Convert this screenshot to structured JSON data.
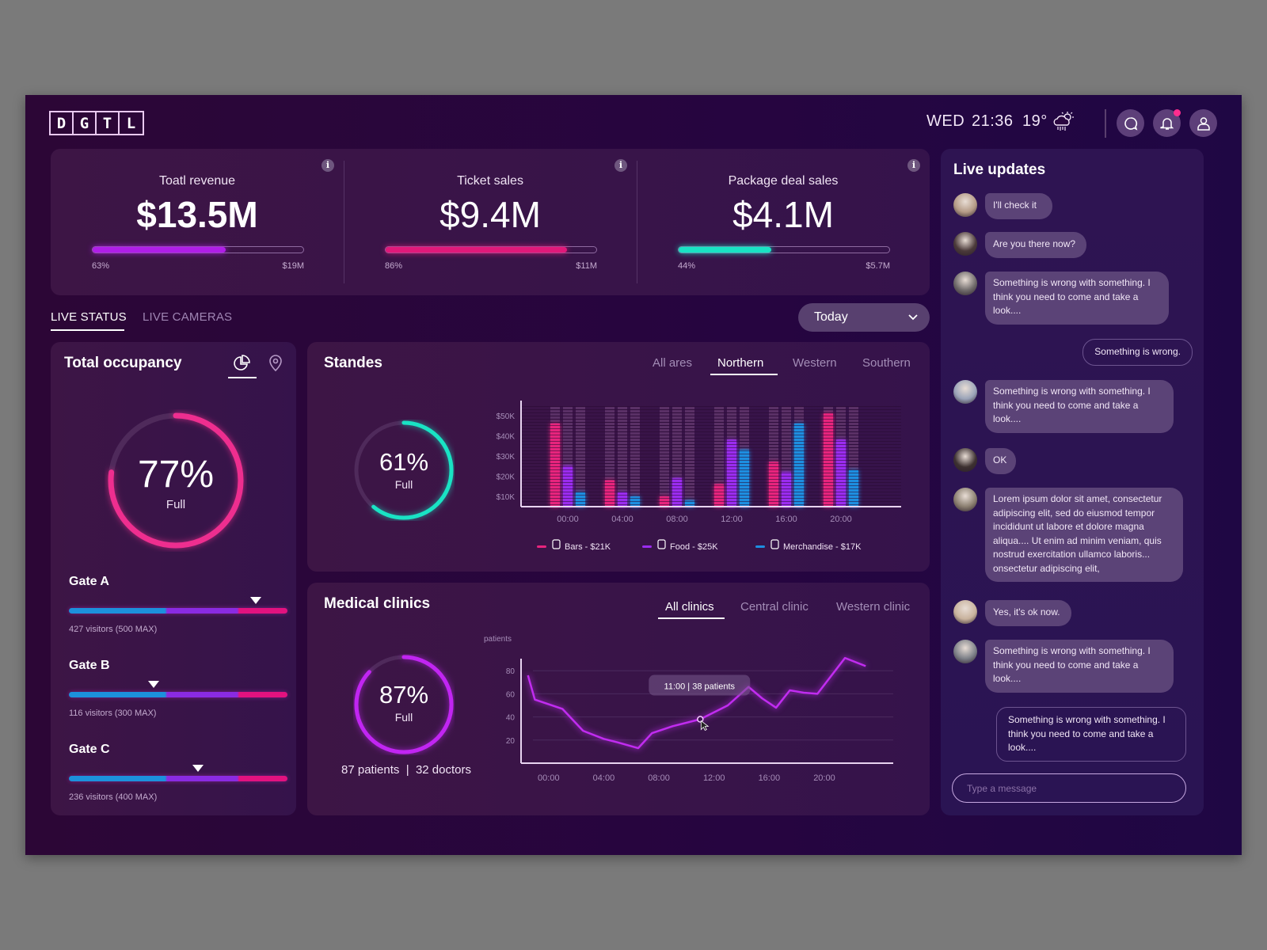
{
  "header": {
    "logo_letters": [
      "D",
      "G",
      "T",
      "L"
    ],
    "day": "WED",
    "time": "21:36",
    "temperature": "19°",
    "weather_icon": "cloud-sun-rain-icon",
    "icons": [
      "chat-icon",
      "bell-icon",
      "user-icon"
    ],
    "has_notification": true
  },
  "kpis": [
    {
      "title": "Toatl revenue",
      "value": "$13.5M",
      "percent_label": "63%",
      "progress": 0.63,
      "max_label": "$19M",
      "color": "#b01ee8"
    },
    {
      "title": "Ticket sales",
      "value": "$9.4M",
      "percent_label": "86%",
      "progress": 0.86,
      "max_label": "$11M",
      "color": "#e0197a"
    },
    {
      "title": "Package deal sales",
      "value": "$4.1M",
      "percent_label": "44%",
      "progress": 0.44,
      "max_label": "$5.7M",
      "color": "#19e3c4"
    }
  ],
  "tabs": {
    "items": [
      {
        "label": "LIVE STATUS",
        "active": true
      },
      {
        "label": "LIVE CAMERAS",
        "active": false
      }
    ],
    "period_selected": "Today"
  },
  "occupancy": {
    "title": "Total occupancy",
    "icons": [
      "pie-chart-icon",
      "map-pin-icon"
    ],
    "percent": 0.77,
    "percent_label": "77%",
    "sub_label": "Full",
    "color": "#ee2e8f",
    "gates": [
      {
        "name": "Gate A",
        "visitors": 427,
        "max": 500,
        "label": "427 visitors (500 MAX)"
      },
      {
        "name": "Gate B",
        "visitors": 116,
        "max": 300,
        "label": "116 visitors (300 MAX)"
      },
      {
        "name": "Gate C",
        "visitors": 236,
        "max": 400,
        "label": "236 visitors (400 MAX)"
      }
    ]
  },
  "standes": {
    "title": "Standes",
    "filters": [
      {
        "label": "All ares",
        "active": false
      },
      {
        "label": "Northern",
        "active": true
      },
      {
        "label": "Western",
        "active": false
      },
      {
        "label": "Southern",
        "active": false
      }
    ],
    "gauge": {
      "percent": 0.61,
      "label": "61%",
      "sub_label": "Full",
      "color": "#19e3c4"
    }
  },
  "medical": {
    "title": "Medical clinics",
    "filters": [
      {
        "label": "All clinics",
        "active": true
      },
      {
        "label": "Central clinic",
        "active": false
      },
      {
        "label": "Western clinic",
        "active": false
      }
    ],
    "gauge": {
      "percent": 0.87,
      "label": "87%",
      "sub_label": "Full",
      "color": "#c125f2"
    },
    "summary": "87 patients  |  32 doctors",
    "tooltip": "11:00  |  38 patients"
  },
  "chart_data": [
    {
      "type": "bar",
      "title": "Standes",
      "categories": [
        "00:00",
        "04:00",
        "08:00",
        "12:00",
        "16:00",
        "20:00"
      ],
      "ylabel": "",
      "yticks": [
        "$10K",
        "$20K",
        "$30K",
        "$40K",
        "$50K"
      ],
      "ylim": [
        5,
        55
      ],
      "series": [
        {
          "name": "Bars - $21K",
          "color": "#e8247d",
          "icon": "beer-mug-icon",
          "values": [
            46,
            18,
            10,
            16,
            27,
            51
          ]
        },
        {
          "name": "Food - $25K",
          "color": "#9b2cf0",
          "icon": "fork-knife-icon",
          "values": [
            25,
            12,
            19,
            38,
            22,
            38
          ]
        },
        {
          "name": "Merchandise - $17K",
          "color": "#1d8ee0",
          "icon": "tshirt-icon",
          "values": [
            12,
            10,
            8,
            33,
            46,
            23
          ]
        }
      ]
    },
    {
      "type": "line",
      "title": "Medical clinics",
      "ylabel": "patients",
      "xticks": [
        "00:00",
        "04:00",
        "08:00",
        "12:00",
        "16:00",
        "20:00"
      ],
      "yticks": [
        20,
        40,
        60,
        80
      ],
      "ylim": [
        0,
        100
      ],
      "xlim": [
        -2,
        25
      ],
      "x": [
        -1.5,
        -1,
        1,
        2.5,
        4,
        5,
        6.5,
        7.5,
        9,
        11,
        13,
        14.5,
        15.5,
        16.5,
        17.5,
        18.5,
        19.5,
        21.5,
        23
      ],
      "values": [
        76,
        55,
        47,
        28,
        21,
        18,
        13,
        26,
        32,
        38,
        50,
        66,
        56,
        48,
        63,
        61,
        60,
        91,
        84
      ],
      "highlight": {
        "x": 11,
        "y": 38,
        "label": "11:00 | 38 patients"
      },
      "line_color": "#c12cf0"
    }
  ],
  "live_updates": {
    "title": "Live updates",
    "messages": [
      {
        "direction": "in",
        "avatar_color": "#b49a86",
        "text": "I'll check it"
      },
      {
        "direction": "in",
        "avatar_color": "#4b3a3a",
        "text": "Are you there now?"
      },
      {
        "direction": "in",
        "avatar_color": "#6f6a6a",
        "text": "Something is wrong with something. I think you need to come and take a look...."
      },
      {
        "direction": "out",
        "text": "Something is wrong."
      },
      {
        "direction": "in",
        "avatar_color": "#9aa3b8",
        "text": "Something is wrong with something. I think you need to come and take a look...."
      },
      {
        "direction": "in",
        "avatar_color": "#3d3131",
        "text": "OK"
      },
      {
        "direction": "in",
        "avatar_color": "#8b7f70",
        "text": "Lorem ipsum dolor sit amet, consectetur adipiscing elit, sed do eiusmod tempor incididunt ut labore et dolore magna aliqua.... Ut enim ad minim veniam, quis nostrud exercitation ullamco laboris... onsectetur adipiscing elit,"
      },
      {
        "direction": "in",
        "avatar_color": "#c8b29d",
        "text": "Yes, it's ok now."
      },
      {
        "direction": "in",
        "avatar_color": "#7d8088",
        "text": "Something is wrong with something. I think you need to come and take a look...."
      },
      {
        "direction": "out",
        "text": "Something is wrong with something. I think you need to come and take a look...."
      }
    ],
    "input_placeholder": "Type a message"
  }
}
